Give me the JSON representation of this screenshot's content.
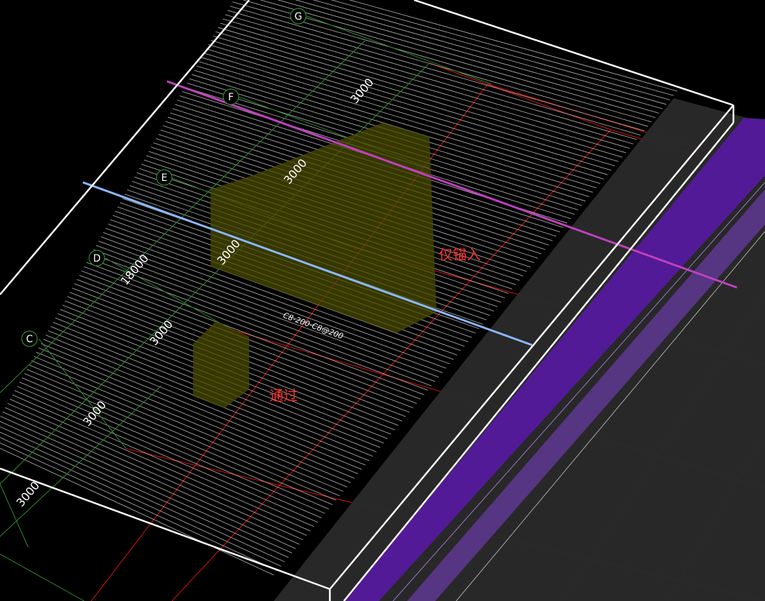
{
  "colors": {
    "background": "#000000",
    "slab_edge": "#ffffff",
    "rebar_lines": "#d9d9d9",
    "axis_green": "#2e8b2e",
    "grid_red": "#e01010",
    "beam_magenta": "#c040c0",
    "beam_blue": "#8ab8ff",
    "wall_purple": "#521a96",
    "wall_dark": "#2a2a2a",
    "opening_fill": "#4a4a00",
    "label_red": "#ff3030"
  },
  "axes": [
    {
      "label": "G"
    },
    {
      "label": "F"
    },
    {
      "label": "E"
    },
    {
      "label": "D"
    },
    {
      "label": "C"
    }
  ],
  "dimensions": [
    {
      "text": "3000"
    },
    {
      "text": "3000"
    },
    {
      "text": "3000"
    },
    {
      "text": "18000"
    },
    {
      "text": "3000"
    },
    {
      "text": "3000"
    },
    {
      "text": "3000"
    }
  ],
  "rebar_annotation": "C8-200-C8@200",
  "zones": [
    {
      "label": "仅锚入",
      "icon": "large-opening"
    },
    {
      "label": "通过",
      "icon": "small-opening"
    }
  ]
}
